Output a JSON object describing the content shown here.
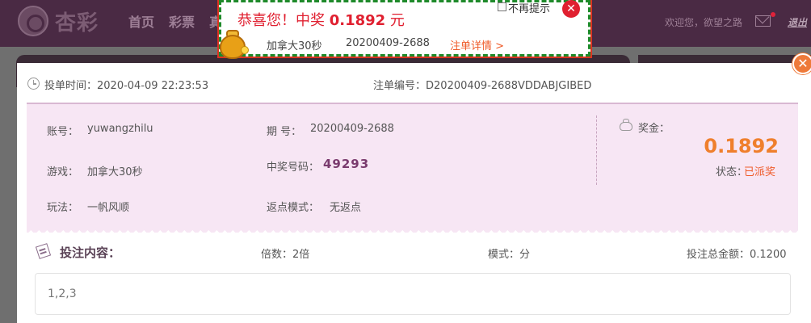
{
  "nav": {
    "logo_text": "杏彩",
    "items": [
      "首页",
      "彩票",
      "真"
    ],
    "welcome": "欢迎您，欲望之路",
    "logout": "退出"
  },
  "win_popup": {
    "title_prefix": "恭喜您！中奖 ",
    "amount": "0.1892",
    "title_suffix": " 元",
    "no_remind_label": "不再提示",
    "close_glyph": "✕",
    "game": "加拿大30秒",
    "issue": "20200409-2688",
    "detail_link": "注单详情 >"
  },
  "modal": {
    "close_glyph": "✕",
    "bet_time_label": "投单时间：",
    "bet_time": "2020-04-09 22:23:53",
    "order_no_label": "注单编号：",
    "order_no": "D20200409-2688VDDABJGIBED",
    "account_label": "账号：",
    "account": "yuwangzhilu",
    "game_label": "游戏：",
    "game": "加拿大30秒",
    "play_label": "玩法：",
    "play": "一帆风顺",
    "issue_label": "期 号：",
    "issue": "20200409-2688",
    "winning_no_label": "中奖号码：",
    "winning_no": "49293",
    "rebate_label": "返点模式：",
    "rebate": "无返点",
    "prize_label": "奖金：",
    "prize": "0.1892",
    "status_label": "状态：",
    "status": "已派奖",
    "content_title": "投注内容：",
    "multiple": "倍数：2倍",
    "mode": "模式：分",
    "total": "投注总金额：0.1200",
    "content": "1,2,3"
  },
  "colors": {
    "nav_bg": "#4a2a44",
    "panel_bg": "#f7e6f4",
    "accent_orange": "#ef7f2c",
    "win_red": "#e02030"
  }
}
